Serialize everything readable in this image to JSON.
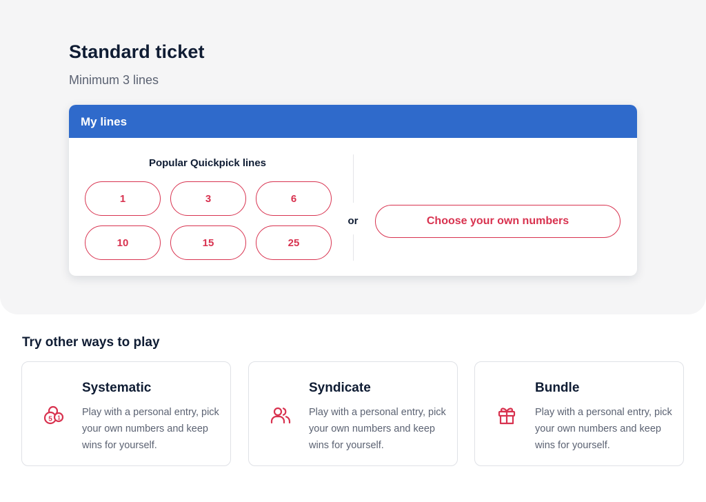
{
  "ticket": {
    "title": "Standard ticket",
    "subtitle": "Minimum 3 lines"
  },
  "my_lines": {
    "header": "My lines",
    "quickpick_title": "Popular Quickpick lines",
    "quickpick_options": [
      "1",
      "3",
      "6",
      "10",
      "15",
      "25"
    ],
    "or_label": "or",
    "choose_label": "Choose your own numbers"
  },
  "other_ways": {
    "title": "Try other ways to play",
    "cards": [
      {
        "name": "Systematic",
        "icon": "lottery-balls-icon",
        "description": "Play with a personal entry, pick your own numbers and keep wins for yourself."
      },
      {
        "name": "Syndicate",
        "icon": "group-icon",
        "description": "Play with a personal entry, pick your own numbers and keep wins for yourself."
      },
      {
        "name": "Bundle",
        "icon": "gift-icon",
        "description": "Play with a personal entry, pick your own numbers and keep wins for yourself."
      }
    ]
  },
  "colors": {
    "accent_red": "#d8324f",
    "header_blue": "#2f6acb",
    "panel_bg": "#f5f5f6",
    "text_dark": "#0f1c33",
    "text_muted": "#5b6272"
  }
}
